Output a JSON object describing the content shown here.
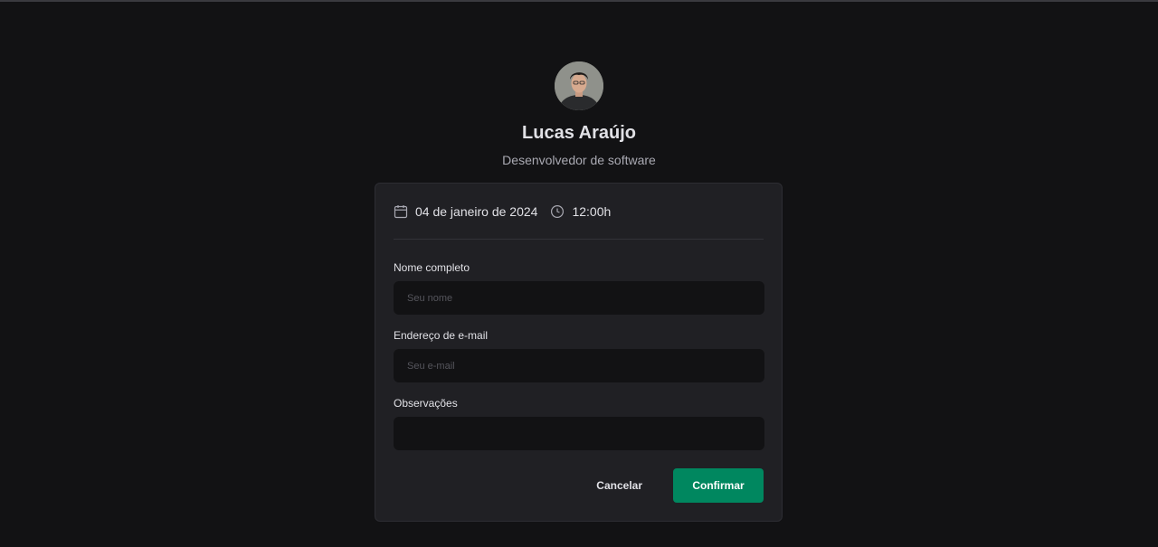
{
  "profile": {
    "name": "Lucas Araújo",
    "role": "Desenvolvedor de software",
    "avatar_icon": "user-avatar-photo"
  },
  "schedule": {
    "date": "04 de janeiro de 2024",
    "time": "12:00h",
    "date_icon": "calendar-icon",
    "time_icon": "clock-icon"
  },
  "form": {
    "name_label": "Nome completo",
    "name_placeholder": "Seu nome",
    "name_value": "",
    "email_label": "Endereço de e-mail",
    "email_placeholder": "Seu e-mail",
    "email_value": "",
    "notes_label": "Observações",
    "notes_value": ""
  },
  "actions": {
    "cancel_label": "Cancelar",
    "confirm_label": "Confirmar"
  },
  "colors": {
    "background": "#121214",
    "card": "#202024",
    "accent": "#00875f",
    "text": "#e1e1e6"
  }
}
